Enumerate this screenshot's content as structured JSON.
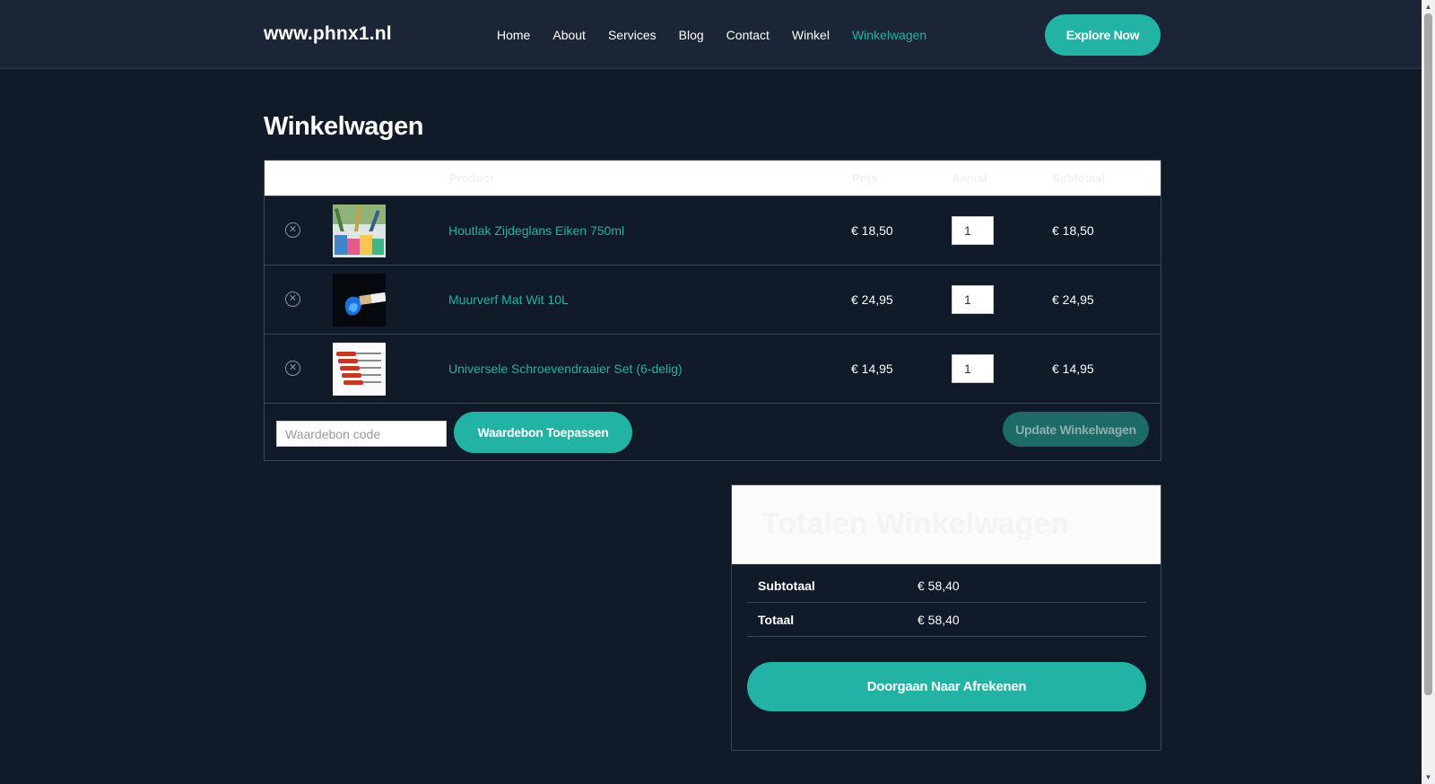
{
  "header": {
    "logo": "www.phnx1.nl",
    "nav": [
      "Home",
      "About",
      "Services",
      "Blog",
      "Contact",
      "Winkel",
      "Winkelwagen"
    ],
    "active_nav": "Winkelwagen",
    "cta": "Explore Now"
  },
  "page": {
    "title": "Winkelwagen"
  },
  "cart": {
    "columns": {
      "product": "Product",
      "price": "Prijs",
      "quantity": "Aantal",
      "subtotal": "Subtotaal"
    },
    "items": [
      {
        "name": "Houtlak Zijdeglans Eiken 750ml",
        "price": "€ 18,50",
        "quantity": "1",
        "subtotal": "€ 18,50",
        "image": "paint-cans-image"
      },
      {
        "name": "Muurverf Mat Wit 10L",
        "price": "€ 24,95",
        "quantity": "1",
        "subtotal": "€ 24,95",
        "image": "paintbrush-image"
      },
      {
        "name": "Universele Schroevendraaier Set (6-delig)",
        "price": "€ 14,95",
        "quantity": "1",
        "subtotal": "€ 14,95",
        "image": "screwdrivers-image"
      }
    ],
    "coupon_placeholder": "Waardebon code",
    "apply_coupon": "Waardebon Toepassen",
    "update_cart": "Update Winkelwagen"
  },
  "totals": {
    "title": "Totalen Winkelwagen",
    "subtotal_label": "Subtotaal",
    "subtotal_value": "€ 58,40",
    "total_label": "Totaal",
    "total_value": "€ 58,40",
    "checkout": "Doorgaan Naar Afrekenen"
  },
  "colors": {
    "background": "#111a28",
    "header": "#1b2535",
    "accent": "#22b3a5"
  }
}
